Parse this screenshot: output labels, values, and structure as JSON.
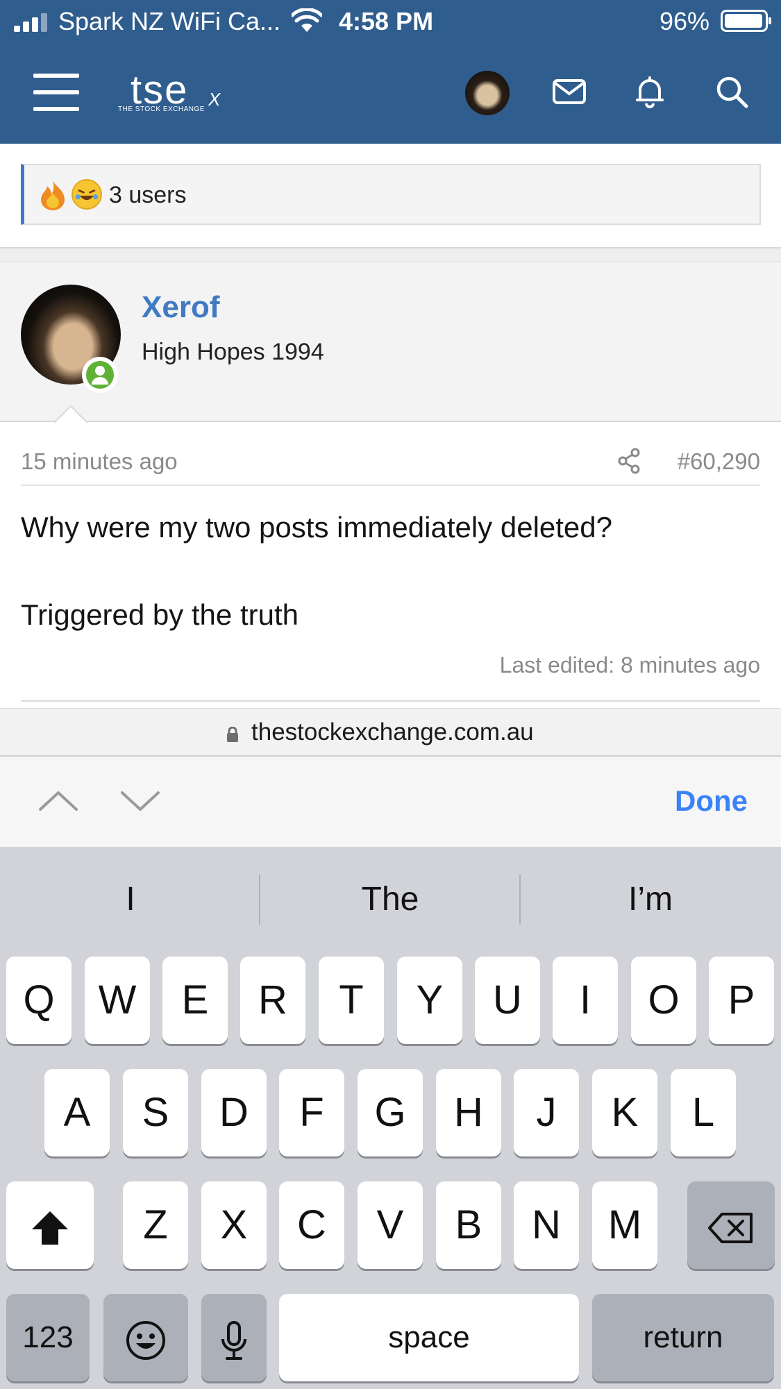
{
  "status_bar": {
    "carrier": "Spark NZ WiFi Ca...",
    "time": "4:58 PM",
    "battery_pct": "96%",
    "battery_level": 0.96
  },
  "nav": {
    "logo_main": "tse",
    "logo_x": "X",
    "logo_sub": "THE STOCK EXCHANGE",
    "icons": [
      "menu-icon",
      "avatar",
      "envelope-icon",
      "bell-icon",
      "search-icon"
    ]
  },
  "reactions": {
    "icons": [
      "fire-icon",
      "laughing-icon"
    ],
    "label": "3 users"
  },
  "post": {
    "author_name": "Xerof",
    "author_title": "High Hopes 1994",
    "time": "15 minutes ago",
    "number": "#60,290",
    "body_line1": "Why were my two posts immediately deleted?",
    "body_line2": "Triggered by the truth",
    "edited": "Last edited: 8 minutes ago"
  },
  "url": {
    "text": "thestockexchange.com.au"
  },
  "form_assist": {
    "done_label": "Done"
  },
  "keyboard": {
    "suggestions": [
      "I",
      "The",
      "I’m"
    ],
    "row1": [
      "Q",
      "W",
      "E",
      "R",
      "T",
      "Y",
      "U",
      "I",
      "O",
      "P"
    ],
    "row2": [
      "A",
      "S",
      "D",
      "F",
      "G",
      "H",
      "J",
      "K",
      "L"
    ],
    "row3": [
      "Z",
      "X",
      "C",
      "V",
      "B",
      "N",
      "M"
    ],
    "numbers_label": "123",
    "space_label": "space",
    "return_label": "return"
  },
  "colors": {
    "header": "#2f5d8e",
    "accent": "#3f7ac2",
    "done": "#3a82f7",
    "online": "#5fb135"
  }
}
